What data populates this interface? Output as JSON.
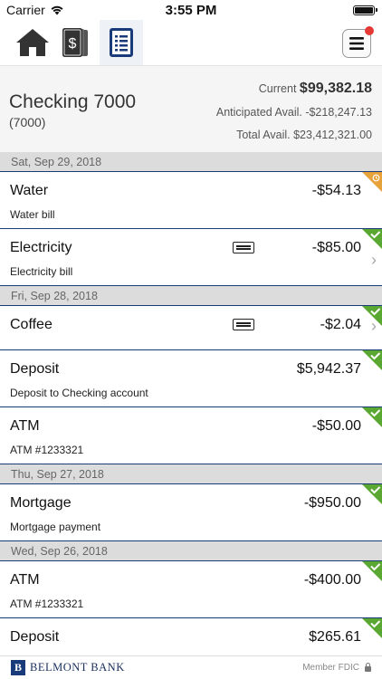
{
  "status_bar": {
    "carrier": "Carrier",
    "time": "3:55 PM"
  },
  "toolbar": {
    "tools": [
      {
        "icon": "home-icon"
      },
      {
        "icon": "dollar-cards-icon"
      },
      {
        "icon": "list-document-icon",
        "active": true
      }
    ],
    "menu_icon": "hamburger-icon"
  },
  "account": {
    "name": "Checking 7000",
    "number": "(7000)",
    "current_label": "Current",
    "current_value": "$99,382.18",
    "anticipated": "Anticipated Avail. -$218,247.13",
    "total": "Total Avail. $23,412,321.00"
  },
  "groups": [
    {
      "date": "Sat, Sep 29, 2018",
      "transactions": [
        {
          "name": "Water",
          "desc": "Water bill",
          "amount": "-$54.13",
          "status": "pending",
          "memo": false,
          "chevron": false
        },
        {
          "name": "Electricity",
          "desc": "Electricity bill",
          "amount": "-$85.00",
          "status": "cleared",
          "memo": true,
          "chevron": true
        }
      ]
    },
    {
      "date": "Fri, Sep 28, 2018",
      "transactions": [
        {
          "name": "Coffee",
          "desc": "",
          "amount": "-$2.04",
          "status": "cleared",
          "memo": true,
          "chevron": true
        },
        {
          "name": "Deposit",
          "desc": "Deposit to Checking account",
          "amount": "$5,942.37",
          "status": "cleared",
          "memo": false,
          "chevron": false
        },
        {
          "name": "ATM",
          "desc": "ATM #1233321",
          "amount": "-$50.00",
          "status": "cleared",
          "memo": false,
          "chevron": false
        }
      ]
    },
    {
      "date": "Thu, Sep 27, 2018",
      "transactions": [
        {
          "name": "Mortgage",
          "desc": "Mortgage payment",
          "amount": "-$950.00",
          "status": "cleared",
          "memo": false,
          "chevron": false
        }
      ]
    },
    {
      "date": "Wed, Sep 26, 2018",
      "transactions": [
        {
          "name": "ATM",
          "desc": "ATM #1233321",
          "amount": "-$400.00",
          "status": "cleared",
          "memo": false,
          "chevron": false
        },
        {
          "name": "Deposit",
          "desc": "",
          "amount": "$265.61",
          "status": "cleared",
          "memo": false,
          "chevron": false
        }
      ]
    }
  ],
  "footer": {
    "bank_name": "BELMONT BANK",
    "logo_letter": "B",
    "member": "Member FDIC"
  },
  "colors": {
    "cleared": "#5aa832",
    "pending": "#e8a23a",
    "divider": "#1a3b7a"
  }
}
